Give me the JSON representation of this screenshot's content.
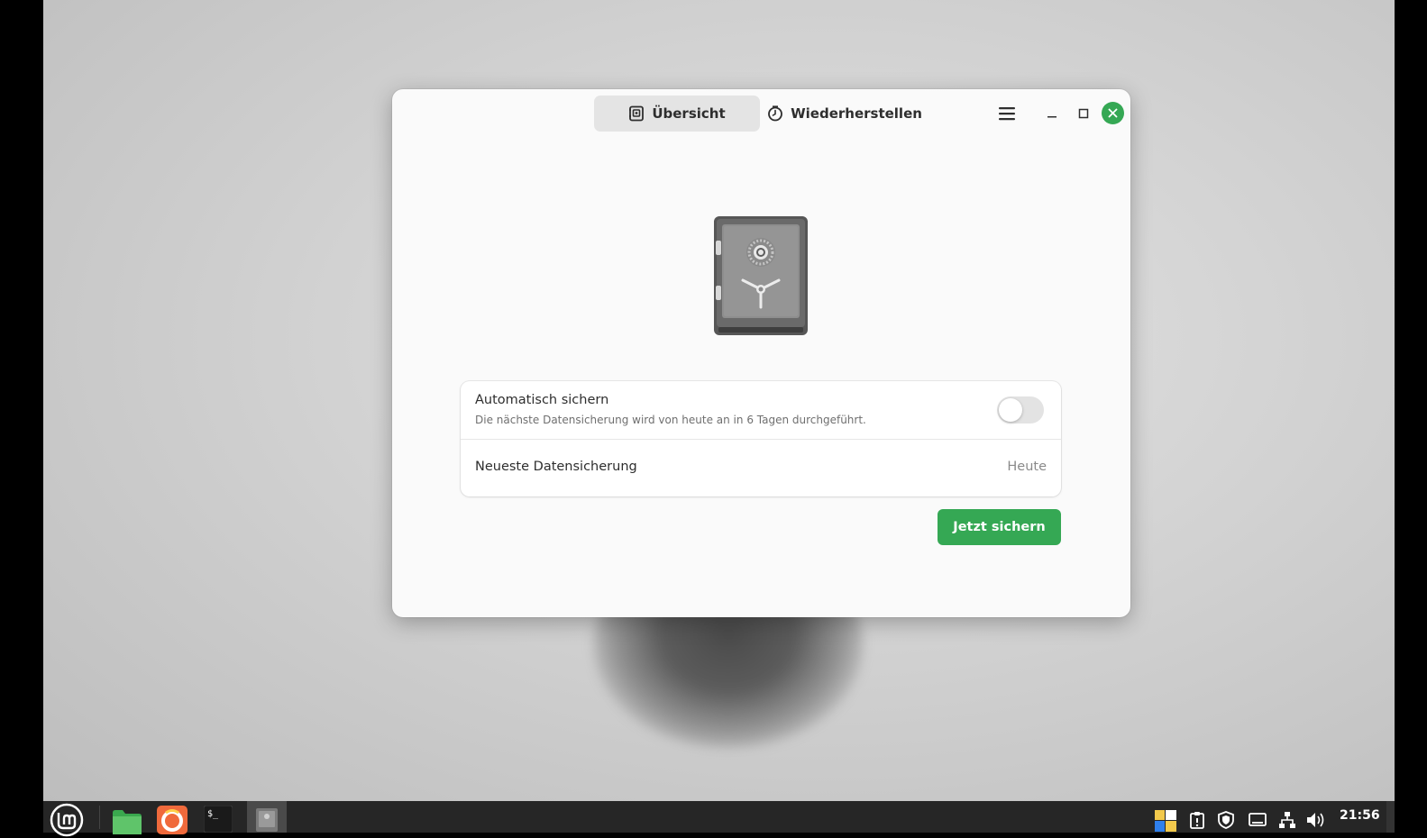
{
  "window": {
    "tabs": [
      {
        "label": "Übersicht",
        "icon": "backup-disk-icon",
        "active": true
      },
      {
        "label": "Wiederherstellen",
        "icon": "clock-icon",
        "active": false
      }
    ],
    "controls": [
      "menu-icon",
      "minimize-icon",
      "maximize-icon",
      "close-icon"
    ],
    "hero_icon": "safe-icon"
  },
  "settings": {
    "auto_backup": {
      "title": "Automatisch sichern",
      "subtitle": "Die nächste Datensicherung wird von heute an in 6 Tagen durchgeführt.",
      "enabled": false
    },
    "latest_backup": {
      "title": "Neueste Datensicherung",
      "value": "Heute"
    }
  },
  "actions": {
    "backup_now_label": "Jetzt sichern"
  },
  "taskbar": {
    "apps": [
      "mint-menu-icon",
      "files-icon",
      "firefox-icon",
      "terminal-icon",
      "backup-app-icon"
    ],
    "tray": [
      "color-picker-icon",
      "clipboard-icon",
      "shield-icon",
      "display-icon",
      "network-icon",
      "volume-icon"
    ],
    "clock": "21:56"
  },
  "colors": {
    "accent": "#35a854",
    "taskbar": "#262626",
    "window_bg": "#fafafa"
  }
}
